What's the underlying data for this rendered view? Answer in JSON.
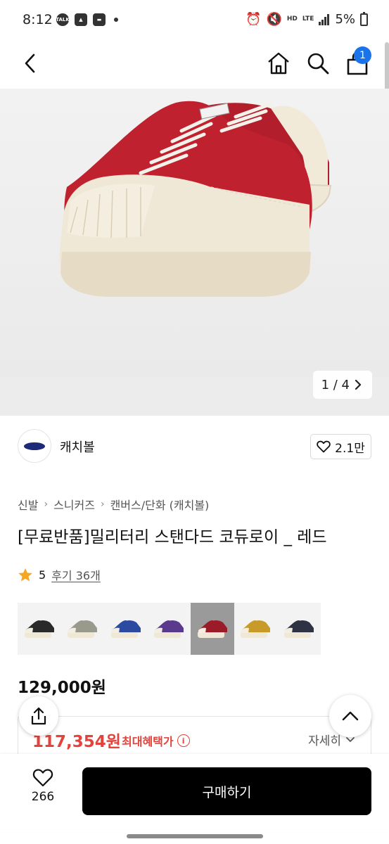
{
  "status_bar": {
    "time": "8:12",
    "battery": "5%",
    "network_primary": "HD",
    "network_secondary": "LTE"
  },
  "nav": {
    "cart_count": "1"
  },
  "gallery": {
    "counter": "1 / 4"
  },
  "brand": {
    "name": "캐치볼",
    "likes": "2.1만"
  },
  "breadcrumb": [
    "신발",
    "스니커즈",
    "캔버스/단화 (캐치볼)"
  ],
  "product": {
    "title": "[무료반품]밀리터리 스탠다드 코듀로이 _ 레드",
    "rating": "5",
    "reviews": "후기 36개"
  },
  "color_options": [
    {
      "color": "#2a2a2a",
      "selected": false
    },
    {
      "color": "#9a9a8c",
      "selected": false
    },
    {
      "color": "#2b4aa0",
      "selected": false
    },
    {
      "color": "#5a3a8c",
      "selected": false
    },
    {
      "color": "#9b1c28",
      "selected": true
    },
    {
      "color": "#c79a2a",
      "selected": false
    },
    {
      "color": "#2e3344",
      "selected": false
    }
  ],
  "pricing": {
    "original": "129,000원",
    "benefit_price": "117,354원",
    "benefit_label": "최대혜택가",
    "detail_link": "자세히"
  },
  "bottom": {
    "wish_count": "266",
    "buy_label": "구매하기"
  },
  "colors": {
    "accent_red": "#e4433c",
    "badge_blue": "#1a73e8",
    "buy_button_bg": "#000000"
  }
}
